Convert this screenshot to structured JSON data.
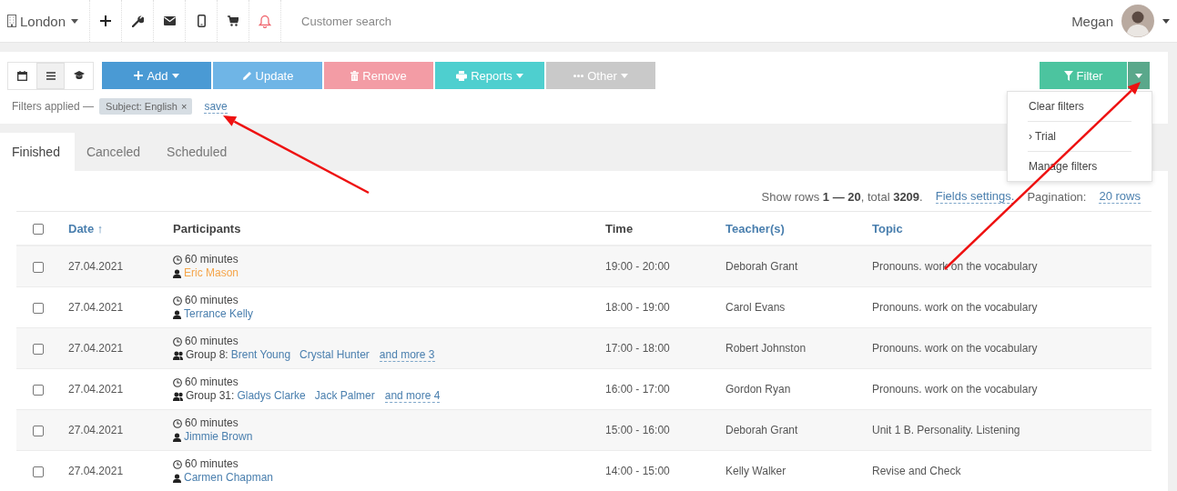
{
  "top_bar": {
    "branch": "London",
    "search": {
      "placeholder": "Customer search"
    },
    "user": {
      "name": "Megan"
    }
  },
  "view_modes": [
    {
      "selected": false
    },
    {
      "selected": true
    },
    {
      "selected": false
    }
  ],
  "actions": [
    {
      "label": "Add",
      "color": "#4a9ad4",
      "dropdown": true
    },
    {
      "label": "Update",
      "color": "#6fb5e6",
      "dropdown": false
    },
    {
      "label": "Remove",
      "color": "#f39ca5",
      "dropdown": false
    },
    {
      "label": "Reports",
      "color": "#4ecfcf",
      "dropdown": true
    },
    {
      "label": "Other",
      "color": "#c9c9c9",
      "dropdown": true
    }
  ],
  "filter_button": {
    "label": "Filter",
    "menu_open": true
  },
  "filter_menu": {
    "items": [
      "Clear filters",
      "› Trial",
      "Manage filters"
    ]
  },
  "filters": {
    "label": "Filters applied —",
    "chips": [
      {
        "label": "Subject: English",
        "remove": "×"
      }
    ],
    "save": "save"
  },
  "tabs": [
    {
      "label": "Finished",
      "selected": true
    },
    {
      "label": "Canceled",
      "selected": false
    },
    {
      "label": "Scheduled",
      "selected": false
    }
  ],
  "summary": {
    "text": "Show rows **1 — 20**, total **3209**.",
    "fields_settings": "Fields settings.",
    "pagination_label": "Pagination:",
    "pagination_value": "20 rows"
  },
  "table": {
    "all_checked": false,
    "columns": [
      {
        "label": "Date",
        "link": true,
        "sort": "↑"
      },
      {
        "label": "Participants",
        "link": false
      },
      {
        "label": "Time",
        "link": false
      },
      {
        "label": "Teacher(s)",
        "link": true
      },
      {
        "label": "Topic",
        "link": true
      }
    ],
    "rows": [
      {
        "checked": false,
        "date": "27.04.2021",
        "duration": "60 minutes",
        "kind": "single",
        "participants": [
          {
            "name": "Eric Mason",
            "color": "#f5a54a"
          }
        ],
        "time": "19:00 - 20:00",
        "teacher": "Deborah Grant",
        "topic": "Pronouns. work on the vocabulary"
      },
      {
        "checked": false,
        "date": "27.04.2021",
        "duration": "60 minutes",
        "kind": "single",
        "participants": [
          {
            "name": "Terrance Kelly",
            "color": "#4a7fae"
          }
        ],
        "time": "18:00 - 19:00",
        "teacher": "Carol Evans",
        "topic": "Pronouns. work on the vocabulary"
      },
      {
        "checked": false,
        "date": "27.04.2021",
        "duration": "60 minutes",
        "kind": "group",
        "group": "Group 8:",
        "participants": [
          {
            "name": "Brent Young",
            "color": "#4a7fae"
          },
          {
            "name": "Crystal Hunter",
            "color": "#4a7fae"
          }
        ],
        "more": "and more 3",
        "time": "17:00 - 18:00",
        "teacher": "Robert Johnston",
        "topic": "Pronouns. work on the vocabulary"
      },
      {
        "checked": false,
        "date": "27.04.2021",
        "duration": "60 minutes",
        "kind": "group",
        "group": "Group 31:",
        "participants": [
          {
            "name": "Gladys Clarke",
            "color": "#4a7fae"
          },
          {
            "name": "Jack Palmer",
            "color": "#4a7fae"
          }
        ],
        "more": "and more 4",
        "time": "16:00 - 17:00",
        "teacher": "Gordon Ryan",
        "topic": "Pronouns. work on the vocabulary"
      },
      {
        "checked": false,
        "date": "27.04.2021",
        "duration": "60 minutes",
        "kind": "single",
        "participants": [
          {
            "name": "Jimmie Brown",
            "color": "#4a7fae"
          }
        ],
        "time": "15:00 - 16:00",
        "teacher": "Deborah Grant",
        "topic": "Unit 1 B. Personality. Listening"
      },
      {
        "checked": false,
        "date": "27.04.2021",
        "duration": "60 minutes",
        "kind": "single",
        "participants": [
          {
            "name": "Carmen Chapman",
            "color": "#4a7fae"
          }
        ],
        "time": "14:00 - 15:00",
        "teacher": "Kelly Walker",
        "topic": "Revise and Check"
      }
    ]
  },
  "annotations": [
    {
      "kind": "arrow"
    },
    {
      "kind": "arrow"
    }
  ]
}
